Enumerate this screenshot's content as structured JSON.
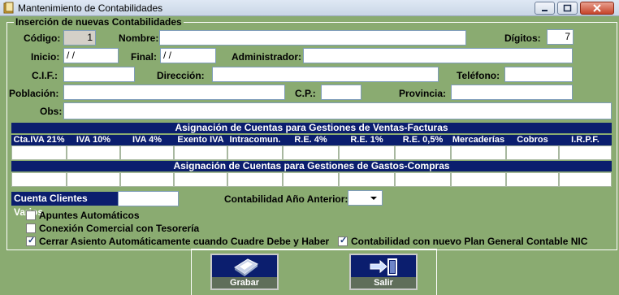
{
  "window": {
    "title": "Mantenimiento de Contabilidades"
  },
  "group_title": "Inserción de nuevas Contabilidades",
  "fields": {
    "codigo": {
      "label": "Código:",
      "value": "1"
    },
    "nombre": {
      "label": "Nombre:",
      "value": ""
    },
    "digitos": {
      "label": "Dígitos:",
      "value": "7"
    },
    "inicio": {
      "label": "Inicio:",
      "value": " / /"
    },
    "final": {
      "label": "Final:",
      "value": " / /"
    },
    "administrador": {
      "label": "Administrador:",
      "value": ""
    },
    "cif": {
      "label": "C.I.F.:",
      "value": ""
    },
    "direccion": {
      "label": "Dirección:",
      "value": ""
    },
    "telefono": {
      "label": "Teléfono:",
      "value": ""
    },
    "poblacion": {
      "label": "Población:",
      "value": ""
    },
    "cp": {
      "label": "C.P.:",
      "value": ""
    },
    "provincia": {
      "label": "Provincia:",
      "value": ""
    },
    "obs": {
      "label": "Obs:",
      "value": ""
    }
  },
  "ventas": {
    "title": "Asignación de Cuentas para Gestiones de Ventas-Facturas",
    "columns": [
      "Cta.IVA 21%",
      "IVA 10%",
      "IVA 4%",
      "Exento IVA",
      "Intracomun.",
      "R.E. 4%",
      "R.E. 1%",
      "R.E. 0,5%",
      "Mercaderías",
      "Cobros",
      "I.R.P.F."
    ]
  },
  "gastos": {
    "title": "Asignación de Cuentas para Gestiones de Gastos-Compras"
  },
  "cuenta_clientes": {
    "label": "Cuenta Clientes Varios",
    "value": ""
  },
  "contab_anterior": {
    "label": "Contabilidad Año Anterior:",
    "value": ""
  },
  "checks": {
    "apuntes": {
      "label": "Apuntes Automáticos",
      "checked": false
    },
    "conexion": {
      "label": "Conexión Comercial con Tesorería",
      "checked": false
    },
    "cerrar": {
      "label": "Cerrar Asiento Automáticamente cuando Cuadre Debe y Haber",
      "checked": true
    },
    "nic": {
      "label": "Contabilidad con nuevo Plan General Contable NIC",
      "checked": true
    }
  },
  "buttons": {
    "grabar": "Grabar",
    "salir": "Salir"
  },
  "icons": {
    "app": "ledger-icon",
    "save": "floppy-disk-icon",
    "exit": "exit-door-icon"
  },
  "colors": {
    "background": "#8aab71",
    "header_bar": "#0b1e6e"
  }
}
